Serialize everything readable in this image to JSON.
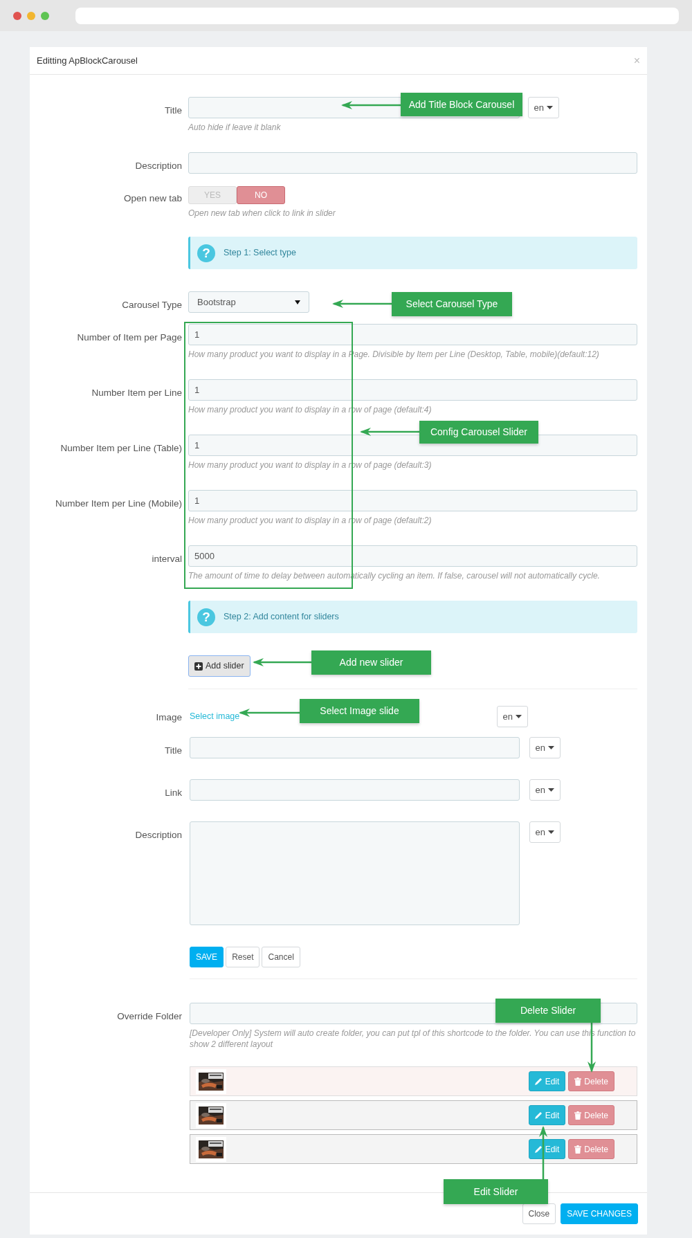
{
  "window": {
    "title": "Editting ApBlockCarousel",
    "close": "×"
  },
  "block_settings": [
    {
      "kind": "text",
      "label": "Title",
      "lang": "en",
      "help": "Auto hide if leave it blank"
    },
    {
      "kind": "text",
      "label": "Description"
    },
    {
      "kind": "toggle",
      "label": "Open new tab",
      "options": [
        {
          "label": "YES",
          "selected": false
        },
        {
          "label": "NO",
          "selected": true
        }
      ],
      "help": "Open new tab when click to link in slider"
    },
    {
      "kind": "alert",
      "icon": "?",
      "text": "Step 1: Select type"
    },
    {
      "kind": "select",
      "label": "Carousel Type",
      "value": "Bootstrap"
    },
    {
      "kind": "text",
      "label": "Number of Item per Page",
      "value": "1",
      "help": "How many product you want to display in a Page. Divisible by Item per Line (Desktop, Table, mobile)(default:12)"
    },
    {
      "kind": "text",
      "label": "Number Item per Line",
      "value": "1",
      "help": "How many product you want to display in a row of page (default:4)"
    },
    {
      "kind": "text",
      "label": "Number Item per Line (Table)",
      "value": "1",
      "help": "How many product you want to display in a row of page (default:3)"
    },
    {
      "kind": "text",
      "label": "Number Item per Line (Mobile)",
      "value": "1",
      "help": "How many product you want to display in a row of page (default:2)"
    },
    {
      "kind": "text",
      "label": "interval",
      "value": "5000",
      "help": "The amount of time to delay between automatically cycling an item. If false, carousel will not automatically cycle."
    },
    {
      "kind": "alert",
      "icon": "?",
      "text": "Step 2: Add content for sliders"
    }
  ],
  "add_slider_button": "Add slider",
  "slider_form": {
    "fields": [
      {
        "kind": "link",
        "label": "Image",
        "text": "Select image",
        "lang": "en"
      },
      {
        "kind": "text",
        "label": "Title",
        "lang": "en"
      },
      {
        "kind": "text",
        "label": "Link",
        "lang": "en"
      },
      {
        "kind": "textarea",
        "label": "Description",
        "lang": "en"
      }
    ],
    "buttons": [
      {
        "label": "SAVE",
        "kind": "primary"
      },
      {
        "label": "Reset",
        "kind": "default"
      },
      {
        "label": "Cancel",
        "kind": "default"
      }
    ]
  },
  "override_folder": {
    "label": "Override Folder",
    "help": "[Developer Only] System will auto create folder, you can put tpl of this shortcode to the folder. You can use this function to show 2 different layout"
  },
  "sliders": [
    {
      "selected": true,
      "edit": "Edit",
      "delete": "Delete"
    },
    {
      "selected": false,
      "edit": "Edit",
      "delete": "Delete"
    },
    {
      "selected": false,
      "edit": "Edit",
      "delete": "Delete"
    }
  ],
  "footer_buttons": [
    {
      "label": "Close",
      "kind": "default"
    },
    {
      "label": "SAVE CHANGES",
      "kind": "primary"
    }
  ],
  "annotations": [
    {
      "text": "Add Title Block Carousel"
    },
    {
      "text": "Select Carousel Type"
    },
    {
      "text": "Config Carousel Slider"
    },
    {
      "text": "Add new slider"
    },
    {
      "text": "Select Image slide"
    },
    {
      "text": "Delete Slider"
    },
    {
      "text": "Edit Slider"
    }
  ]
}
